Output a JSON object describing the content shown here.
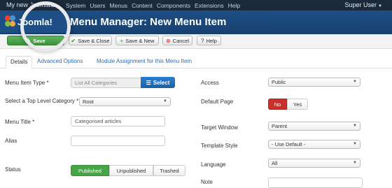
{
  "topbar": {
    "site_name": "My new Joomla...",
    "external_icon": "external-link-icon",
    "menus": [
      "System",
      "Users",
      "Menus",
      "Content",
      "Components",
      "Extensions",
      "Help"
    ],
    "user": "Super User"
  },
  "header": {
    "logo_text": "Joomla!",
    "title": "Menu Manager: New Menu Item"
  },
  "toolbar": {
    "save": "Save",
    "save_close": "Save & Close",
    "save_new": "Save & New",
    "cancel": "Cancel",
    "help": "Help"
  },
  "tabs": [
    "Details",
    "Advanced Options",
    "Module Assignment for this Menu Item"
  ],
  "form_left": {
    "menu_item_type_label": "Menu Item Type *",
    "menu_item_type_value": "List All Categories",
    "select_button": "Select",
    "top_level_label": "Select a Top Level Category *",
    "top_level_value": "Root",
    "menu_title_label": "Menu Title *",
    "menu_title_value": "Categorised articles",
    "alias_label": "Alias",
    "alias_value": "",
    "status_label": "Status",
    "status_options": [
      "Published",
      "Unpublished",
      "Trashed"
    ]
  },
  "form_right": {
    "access_label": "Access",
    "access_value": "Public",
    "default_page_label": "Default Page",
    "default_page_options": [
      "No",
      "Yes"
    ],
    "target_window_label": "Target Window",
    "target_window_value": "Parent",
    "template_style_label": "Template Style",
    "template_style_value": "- Use Default -",
    "language_label": "Language",
    "language_value": "All",
    "note_label": "Note"
  }
}
